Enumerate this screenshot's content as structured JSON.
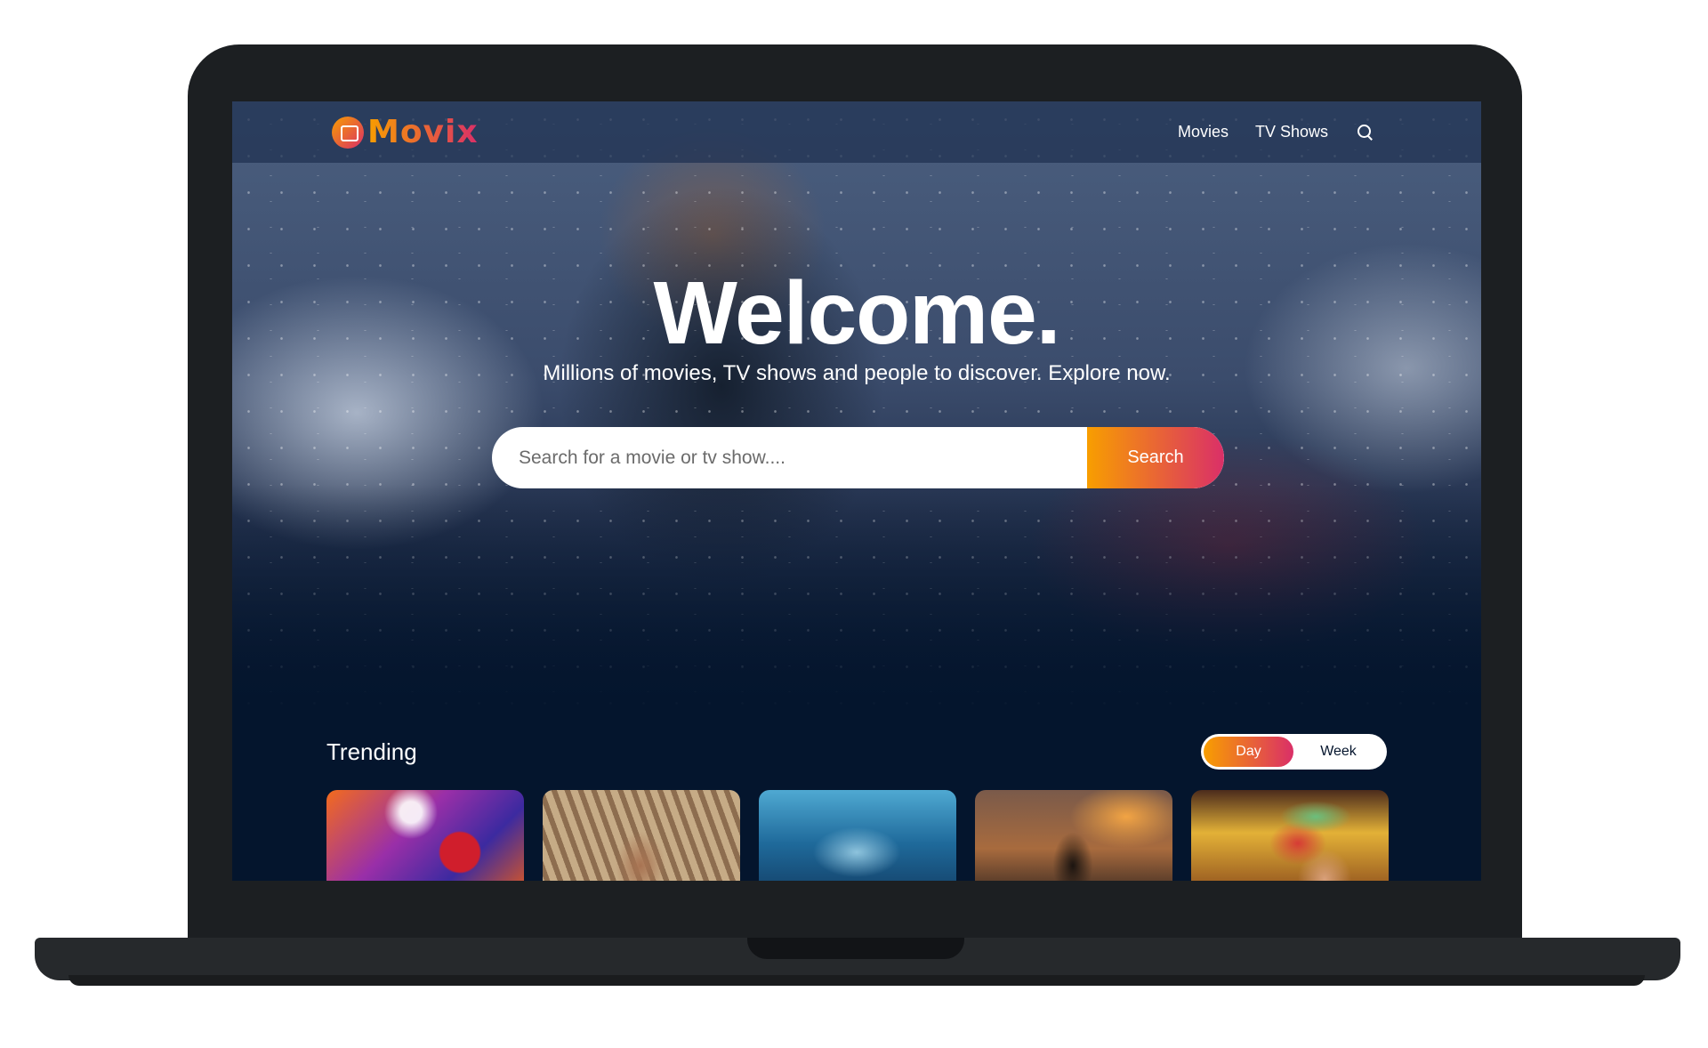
{
  "app": {
    "logo_text": "Movix",
    "brand_gradient": [
      "#f89e00",
      "#da2f68"
    ],
    "background_color": "#04152d"
  },
  "header": {
    "nav": [
      {
        "label": "Movies"
      },
      {
        "label": "TV Shows"
      }
    ],
    "search_icon": "search-icon"
  },
  "hero": {
    "title": "Welcome.",
    "subtitle": "Millions of movies, TV shows and people to discover. Explore now.",
    "search": {
      "placeholder": "Search for a movie or tv show....",
      "value": "",
      "button_label": "Search"
    }
  },
  "trending": {
    "title": "Trending",
    "tabs": [
      {
        "label": "Day",
        "active": true
      },
      {
        "label": "Week",
        "active": false
      }
    ],
    "cards": [
      {
        "poster": "poster-1"
      },
      {
        "poster": "poster-2"
      },
      {
        "poster": "poster-3"
      },
      {
        "poster": "poster-4"
      },
      {
        "poster": "poster-5"
      }
    ]
  }
}
